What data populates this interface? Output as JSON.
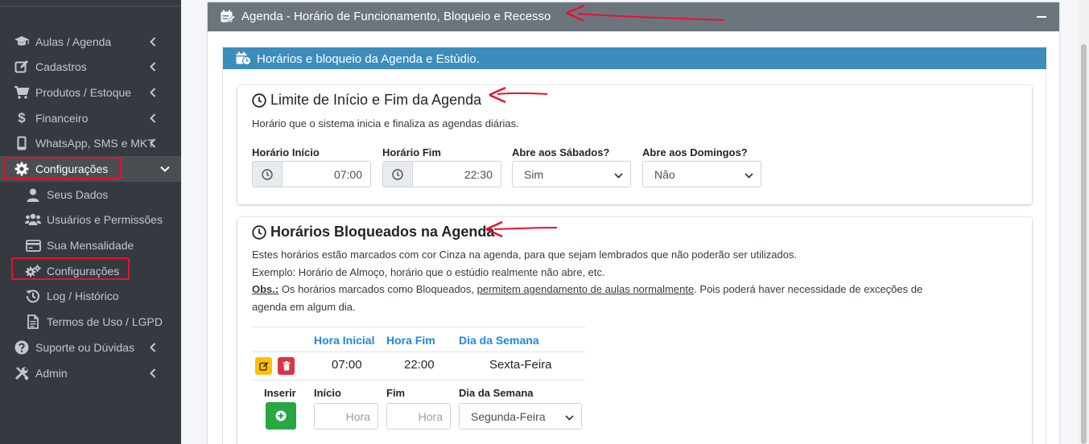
{
  "sidebar": {
    "items": [
      {
        "label": "Aulas / Agenda",
        "icon": "graduation-cap-icon"
      },
      {
        "label": "Cadastros",
        "icon": "edit-icon"
      },
      {
        "label": "Produtos / Estoque",
        "icon": "cart-icon"
      },
      {
        "label": "Financeiro",
        "icon": "dollar-icon"
      },
      {
        "label": "WhatsApp, SMS e MKT",
        "icon": "mobile-icon"
      },
      {
        "label": "Configurações",
        "icon": "gear-icon"
      }
    ],
    "subitems": [
      {
        "label": "Seus Dados",
        "icon": "user-icon"
      },
      {
        "label": "Usuários e Permissões",
        "icon": "users-icon"
      },
      {
        "label": "Sua Mensalidade",
        "icon": "credit-card-icon"
      },
      {
        "label": "Configurações",
        "icon": "gears-icon"
      },
      {
        "label": "Log / Histórico",
        "icon": "history-icon"
      },
      {
        "label": "Termos de Uso / LGPD",
        "icon": "file-icon"
      }
    ],
    "bottom_items": [
      {
        "label": "Suporte ou Dúvidas",
        "icon": "question-icon"
      },
      {
        "label": "Admin",
        "icon": "tools-icon"
      }
    ]
  },
  "card": {
    "title": "Agenda - Horário de Funcionamento, Bloqueio e Recesso"
  },
  "inner": {
    "title": "Horários e bloqueio da Agenda e Estúdio."
  },
  "limits": {
    "title": "Limite de Início e Fim da Agenda",
    "description": "Horário que o sistema inicia e finaliza as agendas diárias.",
    "start_label": "Horário Início",
    "start_value": "07:00",
    "end_label": "Horário Fim",
    "end_value": "22:30",
    "saturday_label": "Abre aos Sábados?",
    "saturday_value": "Sim",
    "sunday_label": "Abre aos Domingos?",
    "sunday_value": "Não"
  },
  "blocked": {
    "title": "Horários Bloqueados na Agenda",
    "line1": "Estes horários estão marcados com cor Cinza na agenda, para que sejam lembrados que não poderão ser utilizados.",
    "line2": "Exemplo: Horário de Almoço, horário que o estúdio realmente não abre, etc.",
    "obs_label": "Obs.:",
    "obs_text1": " Os horários marcados como Bloqueados, ",
    "obs_underlined": "permitem agendamento de aulas normalmente",
    "obs_text2": ". Pois poderá haver necessidade de exceções de",
    "line4": "agenda em algum dia.",
    "table": {
      "headers": [
        "Hora Inicial",
        "Hora Fim",
        "Dia da Semana"
      ],
      "rows": [
        {
          "start": "07:00",
          "end": "22:00",
          "day": "Sexta-Feira"
        }
      ]
    },
    "insert": {
      "insert_label": "Inserir",
      "start_label": "Início",
      "start_placeholder": "Hora",
      "end_label": "Fim",
      "end_placeholder": "Hora",
      "day_label": "Dia da Semana",
      "day_value": "Segunda-Feira"
    }
  },
  "colors": {
    "sidebar_bg": "#343a40",
    "card_header": "#6c757d",
    "inner_header": "#3c8dbc",
    "highlight_red": "#e8112d",
    "table_header_blue": "#1e88e5",
    "edit_yellow": "#ffc107",
    "delete_red": "#dc3545",
    "add_green": "#28a745"
  }
}
